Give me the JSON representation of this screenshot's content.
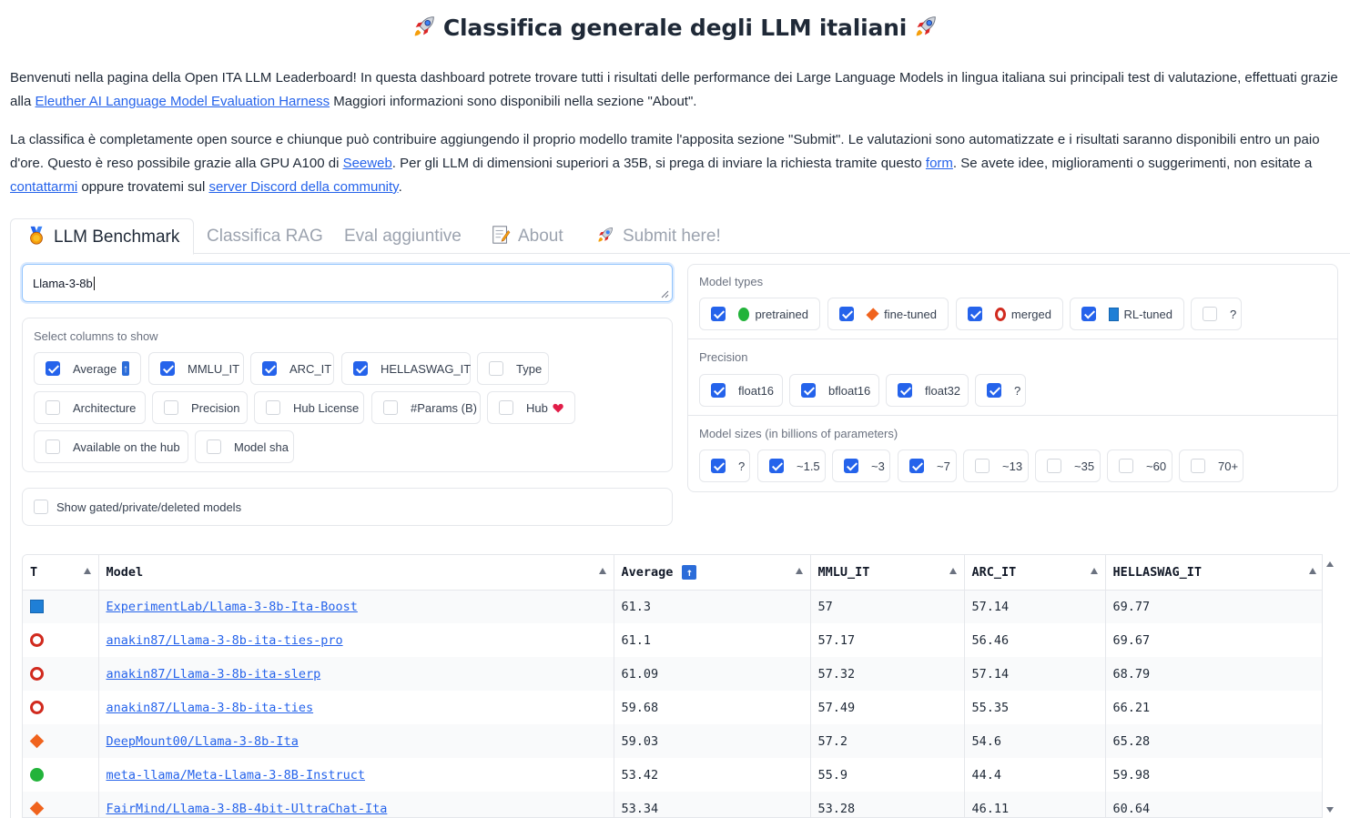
{
  "page": {
    "title": "Classifica generale degli LLM italiani",
    "intro_1a": "Benvenuti nella pagina della Open ITA LLM Leaderboard! In questa dashboard potrete trovare tutti i risultati delle performance dei Large Language Models in lingua italiana sui principali test di valutazione, effettuati grazie alla ",
    "intro_1_link": "Eleuther AI Language Model Evaluation Harness",
    "intro_1b": " Maggiori informazioni sono disponibili nella sezione \"About\".",
    "intro_2a": "La classifica è completamente open source e chiunque può contribuire aggiungendo il proprio modello tramite l'apposita sezione \"Submit\". Le valutazioni sono automatizzate e i risultati saranno disponibili entro un paio d'ore. Questo è reso possibile grazie alla GPU A100 di ",
    "intro_2_link1": "Seeweb",
    "intro_2b": ". Per gli LLM di dimensioni superiori a 35B, si prega di inviare la richiesta tramite questo ",
    "intro_2_link2": "form",
    "intro_2c": ". Se avete idee, miglioramenti o suggerimenti, non esitate a ",
    "intro_2_link3": "contattarmi",
    "intro_2d": " oppure trovatemi sul ",
    "intro_2_link4": "server Discord della community",
    "intro_2e": "."
  },
  "tabs": [
    {
      "label": "LLM Benchmark",
      "icon": "medal-icon"
    },
    {
      "label": "Classifica RAG"
    },
    {
      "label": "Eval aggiuntive"
    },
    {
      "label": "About",
      "icon": "memo-icon"
    },
    {
      "label": "Submit here!",
      "icon": "rocket-icon"
    }
  ],
  "search": {
    "value": "Llama-3-8b"
  },
  "columns": {
    "label": "Select columns to show",
    "items": [
      "Average",
      "MMLU_IT",
      "ARC_IT",
      "HELLASWAG_IT",
      "Type",
      "Architecture",
      "Precision",
      "Hub License",
      "#Params (B)",
      "Hub",
      "Available on the hub",
      "Model sha"
    ]
  },
  "gated": {
    "label": "Show gated/private/deleted models"
  },
  "model_types": {
    "label": "Model types",
    "items": [
      "pretrained",
      "fine-tuned",
      "merged",
      "RL-tuned",
      "?"
    ]
  },
  "precision": {
    "label": "Precision",
    "items": [
      "float16",
      "bfloat16",
      "float32",
      "?"
    ]
  },
  "sizes": {
    "label": "Model sizes (in billions of parameters)",
    "items": [
      "?",
      "~1.5",
      "~3",
      "~7",
      "~13",
      "~35",
      "~60",
      "70+"
    ]
  },
  "table": {
    "headers": [
      "T",
      "Model",
      "Average",
      "MMLU_IT",
      "ARC_IT",
      "HELLASWAG_IT"
    ],
    "rows": [
      {
        "type": "RL-tuned",
        "model": "ExperimentLab/Llama-3-8b-Ita-Boost",
        "avg": "61.3",
        "mmlu": "57",
        "arc": "57.14",
        "hella": "69.77"
      },
      {
        "type": "merged",
        "model": "anakin87/Llama-3-8b-ita-ties-pro",
        "avg": "61.1",
        "mmlu": "57.17",
        "arc": "56.46",
        "hella": "69.67"
      },
      {
        "type": "merged",
        "model": "anakin87/Llama-3-8b-ita-slerp",
        "avg": "61.09",
        "mmlu": "57.32",
        "arc": "57.14",
        "hella": "68.79"
      },
      {
        "type": "merged",
        "model": "anakin87/Llama-3-8b-ita-ties",
        "avg": "59.68",
        "mmlu": "57.49",
        "arc": "55.35",
        "hella": "66.21"
      },
      {
        "type": "fine-tuned",
        "model": "DeepMount00/Llama-3-8b-Ita",
        "avg": "59.03",
        "mmlu": "57.2",
        "arc": "54.6",
        "hella": "65.28"
      },
      {
        "type": "pretrained",
        "model": "meta-llama/Meta-Llama-3-8B-Instruct",
        "avg": "53.42",
        "mmlu": "55.9",
        "arc": "44.4",
        "hella": "59.98"
      },
      {
        "type": "fine-tuned",
        "model": "FairMind/Llama-3-8B-4bit-UltraChat-Ita",
        "avg": "53.34",
        "mmlu": "53.28",
        "arc": "46.11",
        "hella": "60.64"
      }
    ]
  },
  "colors": {
    "accent": "#2563eb",
    "pretrained": "#22b33a",
    "fine_tuned": "#f0631d",
    "merged": "#d12a1e",
    "rl_tuned": "#1f7fd6"
  }
}
